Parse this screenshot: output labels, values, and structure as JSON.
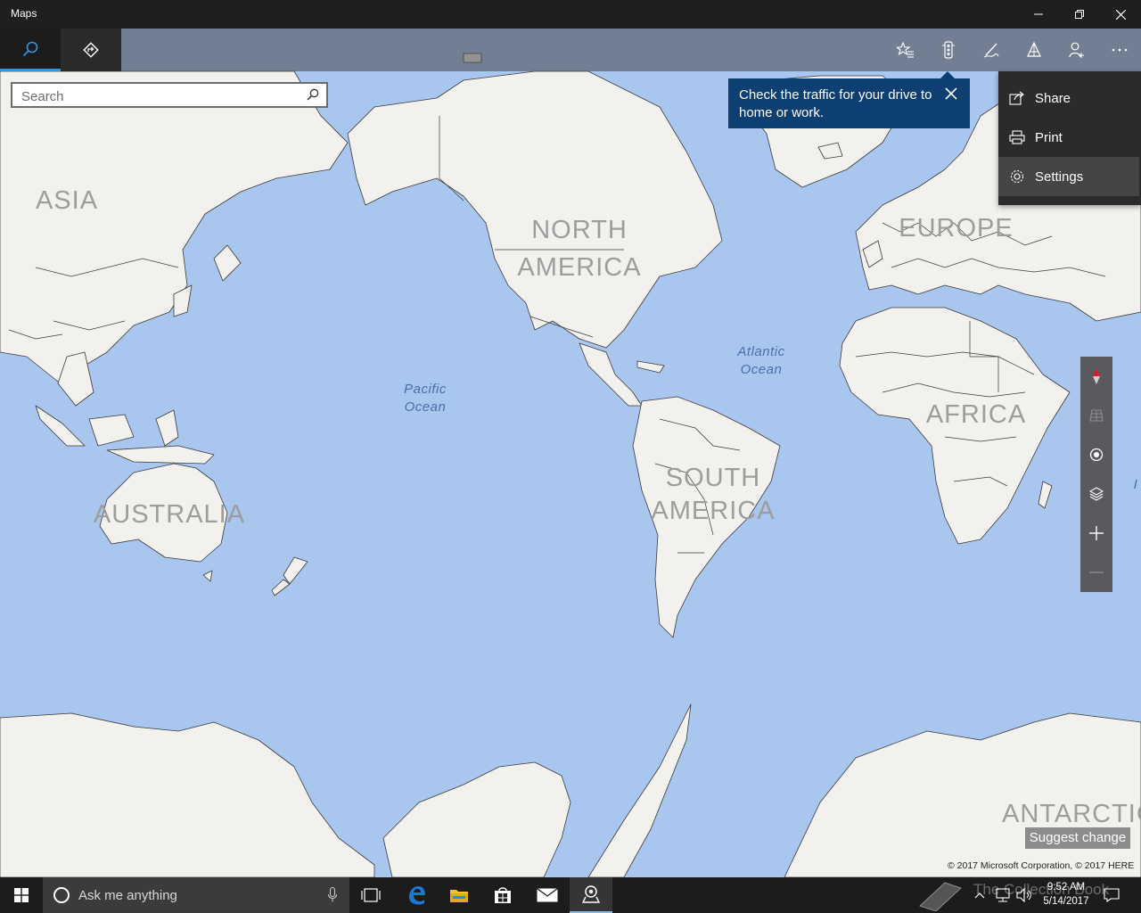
{
  "window": {
    "title": "Maps",
    "minimize_icon": "minimize-icon",
    "maximize_icon": "restore-icon",
    "close_icon": "close-icon"
  },
  "toolbar": {
    "tabs": [
      {
        "name": "search",
        "icon": "search-icon",
        "active": true
      },
      {
        "name": "directions",
        "icon": "directions-icon",
        "active": false
      }
    ],
    "actions": [
      {
        "name": "favorites",
        "icon": "favorites-icon"
      },
      {
        "name": "traffic",
        "icon": "traffic-icon"
      },
      {
        "name": "ink",
        "icon": "ink-pen-icon"
      },
      {
        "name": "3d-cities",
        "icon": "3d-cities-icon"
      },
      {
        "name": "sign-in",
        "icon": "person-add-icon"
      },
      {
        "name": "more",
        "icon": "more-icon"
      }
    ]
  },
  "search": {
    "placeholder": "Search",
    "value": ""
  },
  "tip": {
    "text": "Check the traffic for your drive to home or work."
  },
  "more_menu": {
    "items": [
      {
        "label": "Share",
        "icon": "share-icon"
      },
      {
        "label": "Print",
        "icon": "print-icon"
      },
      {
        "label": "Settings",
        "icon": "gear-icon",
        "highlighted": true
      }
    ]
  },
  "map": {
    "continents": [
      "ASIA",
      "NORTH",
      "AMERICA",
      "EUROPE",
      "AFRICA",
      "AUSTRALIA",
      "SOUTH",
      "AMERICA",
      "ANTARCTIC"
    ],
    "oceans": [
      {
        "line1": "Pacific",
        "line2": "Ocean"
      },
      {
        "line1": "Atlantic",
        "line2": "Ocean"
      }
    ],
    "edge_label": "I",
    "suggest_change": "Suggest change",
    "copyright": "© 2017 Microsoft Corporation, © 2017 HERE",
    "colors": {
      "water": "#a9c6ee",
      "land": "#f2f1ee",
      "border": "#3a3a3a"
    }
  },
  "map_controls": [
    {
      "name": "compass",
      "icon": "compass-icon"
    },
    {
      "name": "tilt",
      "icon": "tilt-icon"
    },
    {
      "name": "my-location",
      "icon": "location-icon"
    },
    {
      "name": "map-views",
      "icon": "layers-icon"
    },
    {
      "name": "zoom-in",
      "icon": "plus-icon"
    },
    {
      "name": "zoom-out",
      "icon": "minus-icon"
    }
  ],
  "taskbar": {
    "cortana_placeholder": "Ask me anything",
    "apps": [
      {
        "name": "task-view",
        "icon": "task-view-icon"
      },
      {
        "name": "edge",
        "icon": "edge-icon"
      },
      {
        "name": "file-explorer",
        "icon": "folder-icon"
      },
      {
        "name": "store",
        "icon": "store-icon"
      },
      {
        "name": "mail",
        "icon": "mail-icon"
      },
      {
        "name": "maps",
        "icon": "maps-icon",
        "running": true
      }
    ],
    "clock_time": "9:52 AM",
    "clock_date": "5/14/2017",
    "watermark": "The Collection Book"
  }
}
